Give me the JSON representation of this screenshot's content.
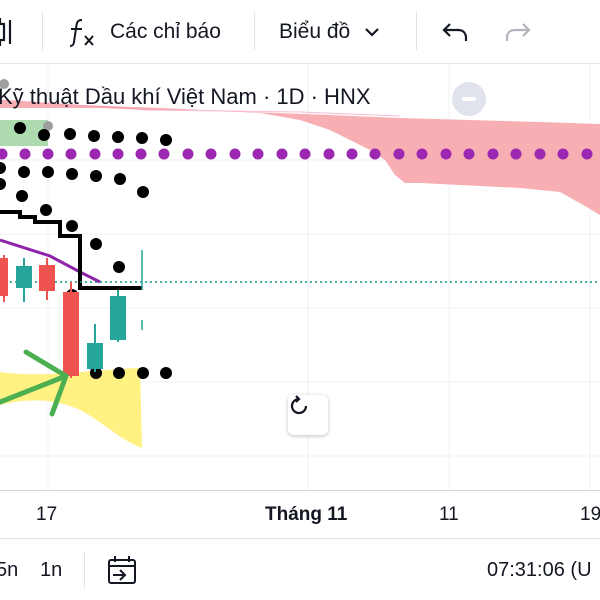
{
  "toolbar": {
    "indicators_label": "Các chỉ báo",
    "chart_type_label": "Biểu đồ",
    "icons": [
      "candles-icon",
      "function-icon",
      "chevron-down-icon",
      "undo-icon",
      "redo-icon"
    ]
  },
  "legend": {
    "title": "Kỹ thuật Dầu khí Việt Nam · 1D · HNX"
  },
  "time_axis": {
    "ticks": [
      "17",
      "Tháng 11",
      "11",
      "19"
    ]
  },
  "bottom_bar": {
    "range_5m": "5n",
    "range_1m": "1n",
    "clock": "07:31:06 (U"
  },
  "colors": {
    "up": "#26a69a",
    "down": "#ef5350",
    "cloud": "#f7a1a6",
    "cloud_green": "#a5d6a7",
    "ichimoku_purple": "#9c27b0",
    "price_line": "#089981",
    "highlight": "#fff176"
  }
}
